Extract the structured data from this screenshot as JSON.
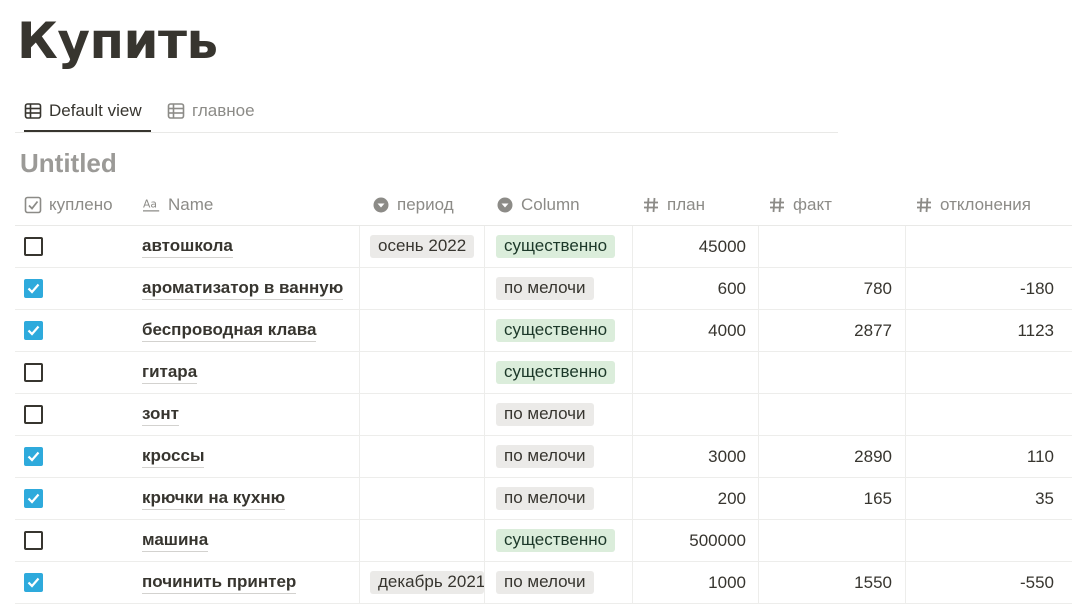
{
  "page": {
    "title": "Купить"
  },
  "tabs": [
    {
      "label": "Default view",
      "icon": "table-icon",
      "active": true
    },
    {
      "label": "главное",
      "icon": "table-icon",
      "active": false
    }
  ],
  "section": {
    "title": "Untitled"
  },
  "table": {
    "columns": {
      "bought": {
        "label": "куплено",
        "icon": "checkbox-icon"
      },
      "name": {
        "label": "Name",
        "icon": "text-aa-icon"
      },
      "period": {
        "label": "период",
        "icon": "select-icon"
      },
      "column": {
        "label": "Column",
        "icon": "select-icon"
      },
      "plan": {
        "label": "план",
        "icon": "hash-icon"
      },
      "fact": {
        "label": "факт",
        "icon": "hash-icon"
      },
      "deviation": {
        "label": "отклонения",
        "icon": "hash-icon"
      }
    },
    "rows": [
      {
        "bought": false,
        "name": "автошкола",
        "period": "осень 2022",
        "column": "существенно",
        "plan": "45000",
        "fact": "",
        "deviation": ""
      },
      {
        "bought": true,
        "name": "ароматизатор в ванную",
        "period": "",
        "column": "по мелочи",
        "plan": "600",
        "fact": "780",
        "deviation": "-180"
      },
      {
        "bought": true,
        "name": "беспроводная клава",
        "period": "",
        "column": "существенно",
        "plan": "4000",
        "fact": "2877",
        "deviation": "1123"
      },
      {
        "bought": false,
        "name": "гитара",
        "period": "",
        "column": "существенно",
        "plan": "",
        "fact": "",
        "deviation": ""
      },
      {
        "bought": false,
        "name": "зонт",
        "period": "",
        "column": "по мелочи",
        "plan": "",
        "fact": "",
        "deviation": ""
      },
      {
        "bought": true,
        "name": "кроссы",
        "period": "",
        "column": "по мелочи",
        "plan": "3000",
        "fact": "2890",
        "deviation": "110"
      },
      {
        "bought": true,
        "name": "крючки на кухню",
        "period": "",
        "column": "по мелочи",
        "plan": "200",
        "fact": "165",
        "deviation": "35"
      },
      {
        "bought": false,
        "name": "машина",
        "period": "",
        "column": "существенно",
        "plan": "500000",
        "fact": "",
        "deviation": ""
      },
      {
        "bought": true,
        "name": "починить принтер",
        "period": "декабрь 2021",
        "column": "по мелочи",
        "plan": "1000",
        "fact": "1550",
        "deviation": "-550"
      }
    ]
  },
  "colors": {
    "checked": "#2eaadc",
    "tag_gray_bg": "#ebeae8",
    "tag_green_bg": "#dbeddb",
    "muted_text": "#8c8b87"
  }
}
